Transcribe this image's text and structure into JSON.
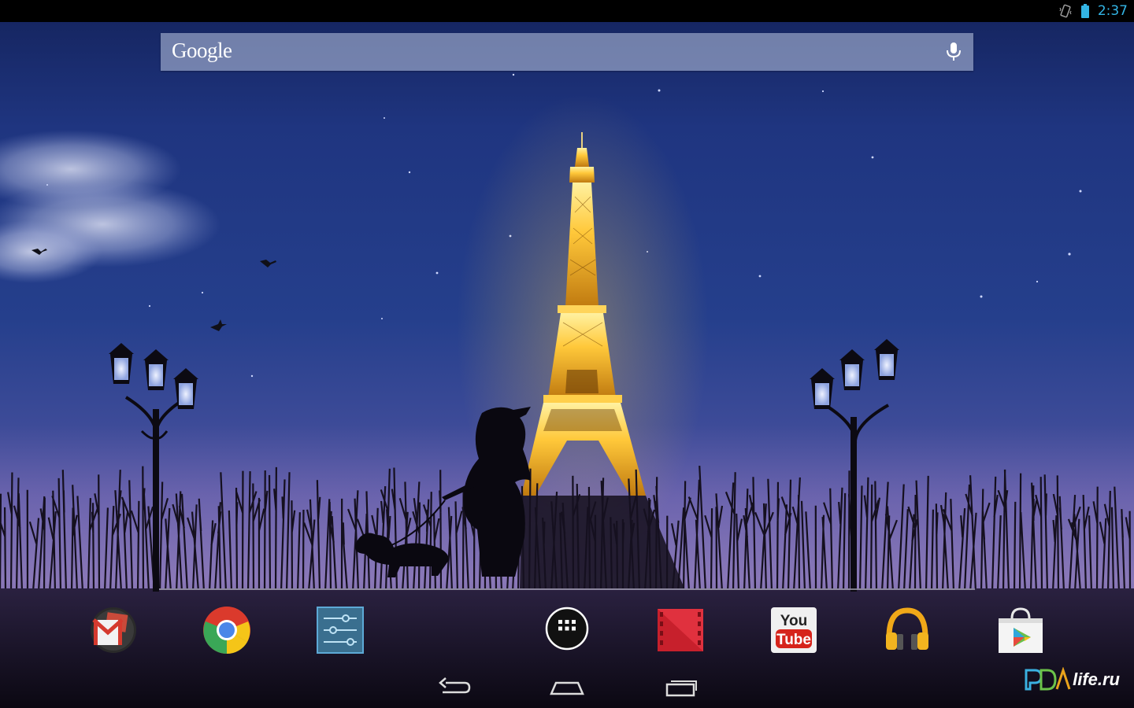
{
  "status_bar": {
    "time": "2:37",
    "icons": [
      "vibrate-icon",
      "battery-icon"
    ],
    "clock_color": "#33b5e5"
  },
  "search": {
    "logo_text": "Google",
    "icon": "mic-icon"
  },
  "dock": {
    "apps": [
      {
        "label": "Gmail",
        "icon": "gmail-icon"
      },
      {
        "label": "Chrome",
        "icon": "chrome-icon"
      },
      {
        "label": "Settings",
        "icon": "settings-icon"
      },
      {
        "label": "Apps",
        "icon": "all-apps-icon"
      },
      {
        "label": "Play Movies",
        "icon": "movies-icon"
      },
      {
        "label": "YouTube",
        "icon": "youtube-icon",
        "text_top": "You",
        "text_bottom": "Tube"
      },
      {
        "label": "Play Music",
        "icon": "headphones-icon"
      },
      {
        "label": "Play Store",
        "icon": "play-store-icon"
      }
    ]
  },
  "nav_bar": {
    "buttons": [
      {
        "label": "Back",
        "icon": "back-icon"
      },
      {
        "label": "Home",
        "icon": "home-icon"
      },
      {
        "label": "Recent apps",
        "icon": "recents-icon"
      }
    ]
  },
  "watermark": {
    "logo_text": "PDA",
    "text": "life.ru"
  },
  "colors": {
    "sky_top": "#1b2d6e",
    "sky_mid": "#26428e",
    "horizon": "#7d6fb4",
    "tower_glow": "#ffc93a",
    "accent": "#33b5e5"
  }
}
